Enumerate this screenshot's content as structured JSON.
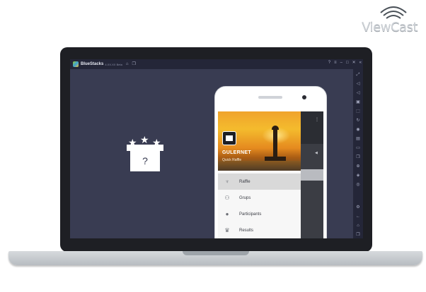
{
  "branding": {
    "logo_text": "ViewCast"
  },
  "window": {
    "app_name": "BlueStacks",
    "version": "4.XX.XX Beta",
    "titlebar_icons": [
      "home-icon",
      "copy-icon"
    ],
    "controls": [
      "help-icon",
      "menu-icon",
      "minimize-icon",
      "restore-icon",
      "close-icon",
      "collapse-icon"
    ]
  },
  "sidebar": {
    "icons": [
      "fullscreen-icon",
      "volume-up-icon",
      "volume-down-icon",
      "play-icon",
      "screenshot-icon",
      "rotate-icon",
      "camera-icon",
      "keyboard-icon",
      "folder-icon",
      "copy-icon",
      "gamepad-icon",
      "layers-icon",
      "sync-icon",
      "settings-icon",
      "back-icon",
      "home-icon",
      "recent-apps-icon"
    ]
  },
  "placeholder": {
    "symbol": "?"
  },
  "app": {
    "header_title": "GULERNET",
    "header_subtitle": "Quick Raffle",
    "menu": [
      {
        "label": "Raffle",
        "icon": "raffle-icon",
        "active": true
      },
      {
        "label": "Grups",
        "icon": "group-icon",
        "active": false
      },
      {
        "label": "Participants",
        "icon": "person-icon",
        "active": false
      },
      {
        "label": "Results",
        "icon": "crown-icon",
        "active": false
      }
    ]
  }
}
